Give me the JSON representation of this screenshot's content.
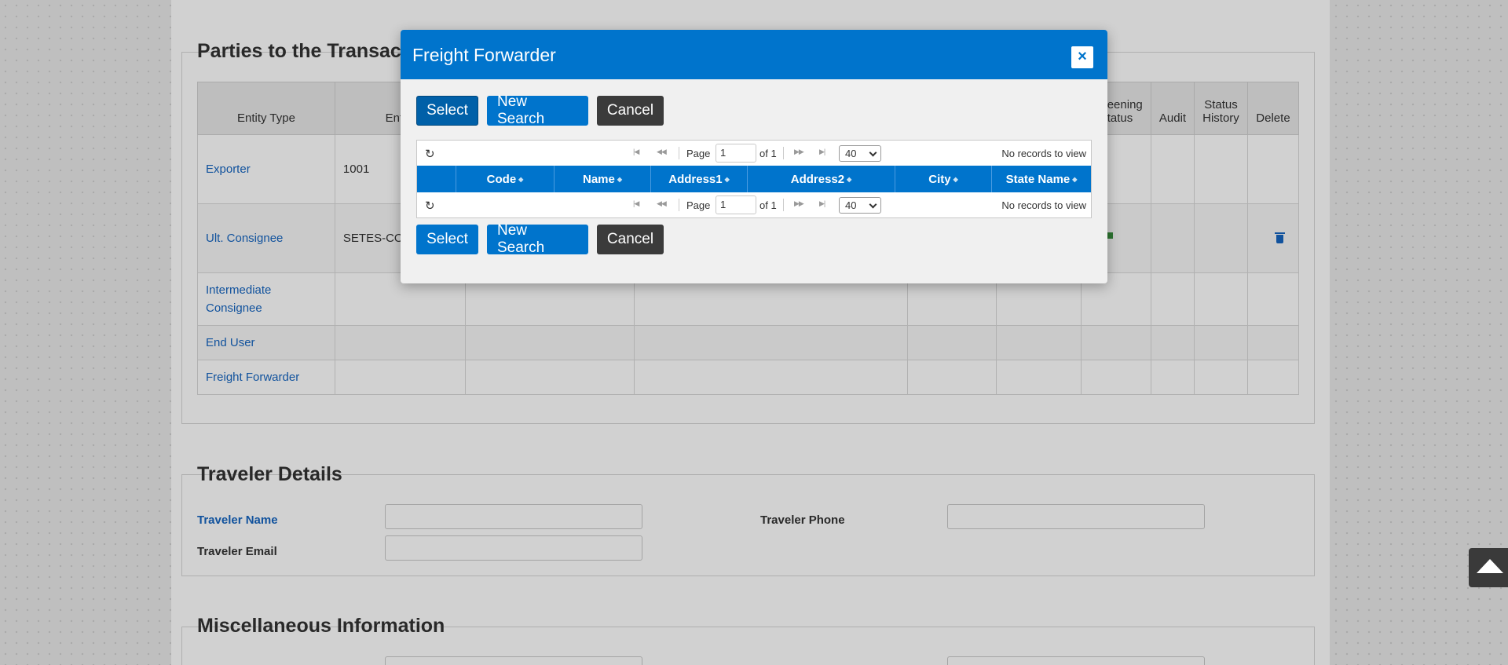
{
  "parties": {
    "title": "Parties to the Transaction",
    "headers": [
      "Entity Type",
      "Entity",
      "",
      "",
      "",
      "",
      "Screening Status",
      "Audit",
      "Status History",
      "Delete"
    ],
    "rows": [
      {
        "type": "Exporter",
        "entity": "1001"
      },
      {
        "type": "Ult. Consignee",
        "entity": "SETES-CO"
      },
      {
        "type": "Intermediate Consignee",
        "entity": ""
      },
      {
        "type": "End User",
        "entity": ""
      },
      {
        "type": "Freight Forwarder",
        "entity": ""
      }
    ]
  },
  "traveler": {
    "title": "Traveler Details",
    "name_label": "Traveler Name",
    "phone_label": "Traveler Phone",
    "email_label": "Traveler Email"
  },
  "misc": {
    "title": "Miscellaneous Information"
  },
  "modal": {
    "title": "Freight Forwarder",
    "close": "×",
    "buttons": {
      "select": "Select",
      "new_search": "New Search",
      "cancel": "Cancel"
    },
    "pager": {
      "page_label": "Page",
      "page_value": "1",
      "of_label": "of 1",
      "rows_per_page": "40",
      "records": "No records to view"
    },
    "columns": [
      "",
      "Code",
      "Name",
      "Address1",
      "Address2",
      "City",
      "State Name"
    ]
  },
  "colors": {
    "primary": "#0074cc",
    "dark": "#3b3b3b",
    "link": "#1565c0",
    "flag": "#388e3c"
  }
}
